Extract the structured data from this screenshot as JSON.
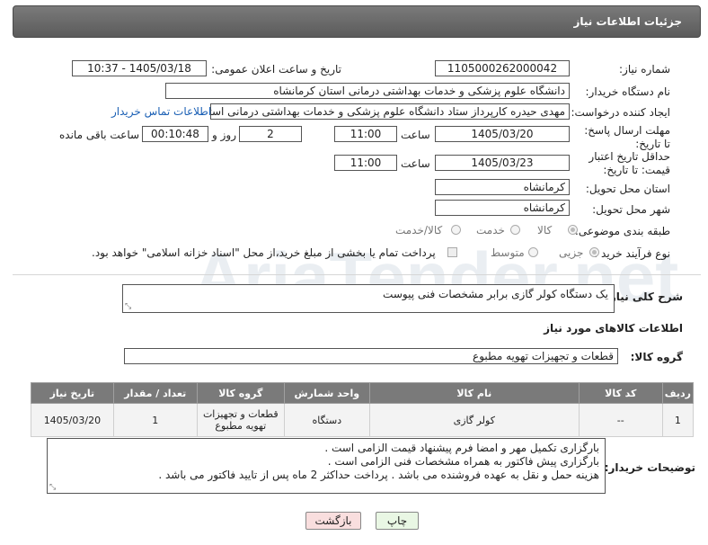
{
  "header": {
    "title": "جزئیات اطلاعات نیاز"
  },
  "fields": {
    "need_number_label": "شماره نیاز:",
    "need_number": "1105000262000042",
    "announce_label": "تاریخ و ساعت اعلان عمومی:",
    "announce_value": "1405/03/18 - 10:37",
    "buyer_org_label": "نام دستگاه خریدار:",
    "buyer_org": "دانشگاه علوم پزشکی و خدمات بهداشتی  درمانی استان کرمانشاه",
    "creator_label": "ایجاد کننده درخواست:",
    "creator": "مهدی حیدره کارپرداز ستاد دانشگاه علوم پزشکی و خدمات بهداشتی  درمانی استان کرمانشاه",
    "buyer_contact_link": "اطلاعات تماس خریدار",
    "reply_deadline_label": "مهلت ارسال پاسخ: تا تاریخ:",
    "reply_date": "1405/03/20",
    "time_label": "ساعت",
    "reply_time": "11:00",
    "days_value": "2",
    "days_label": "روز و",
    "remaining_time": "00:10:48",
    "remaining_label": "ساعت باقی مانده",
    "validity_label": "حداقل تاریخ اعتبار قیمت: تا تاریخ:",
    "validity_date": "1405/03/23",
    "validity_time": "11:00",
    "province_label": "استان محل تحویل:",
    "province": "کرمانشاه",
    "city_label": "شهر محل تحویل:",
    "city": "کرمانشاه",
    "category_label": "طبقه بندی موضوعی:",
    "category_options": [
      "کالا",
      "خدمت",
      "کالا/خدمت"
    ],
    "process_label": "نوع فرآیند خرید :",
    "process_options": [
      "جزیی",
      "متوسط"
    ],
    "payment_note": "پرداخت تمام یا بخشی از مبلغ خرید،از محل \"اسناد خزانه اسلامی\" خواهد بود."
  },
  "description": {
    "label": "شرح کلی نیاز:",
    "value": "یک دستگاه کولر گازی برابر مشخصات فنی پیوست"
  },
  "goods": {
    "section_title": "اطلاعات کالاهای مورد نیاز",
    "group_label": "گروه کالا:",
    "group_value": "قطعات و تجهیزات تهویه مطبوع"
  },
  "table": {
    "headers": [
      "ردیف",
      "کد کالا",
      "نام کالا",
      "واحد شمارش",
      "گروه کالا",
      "تعداد / مقدار",
      "تاریخ نیاز"
    ],
    "rows": [
      [
        "1",
        "--",
        "کولر گازی",
        "دستگاه",
        "قطعات و تجهیزات تهویه مطبوع",
        "1",
        "1405/03/20"
      ]
    ]
  },
  "buyer_notes": {
    "label": "توضیحات خریدار:",
    "lines": [
      "بارگزاری تکمیل مهر و امضا فرم پیشنهاد قیمت الزامی است .",
      "بارگزاری پیش فاکتور به همراه مشخصات فنی الزامی است .",
      "هزینه حمل و نقل به عهده فروشنده می باشد . پرداخت حداکثر 2 ماه پس از تایید فاکتور می باشد ."
    ]
  },
  "buttons": {
    "print": "چاپ",
    "back": "بازگشت"
  },
  "watermark": "AriaTender.net",
  "colors": {
    "header_bg": "#6a6a6a",
    "link": "#1a5fb4",
    "print_btn": "#e9f7e4",
    "back_btn": "#f9dede"
  }
}
